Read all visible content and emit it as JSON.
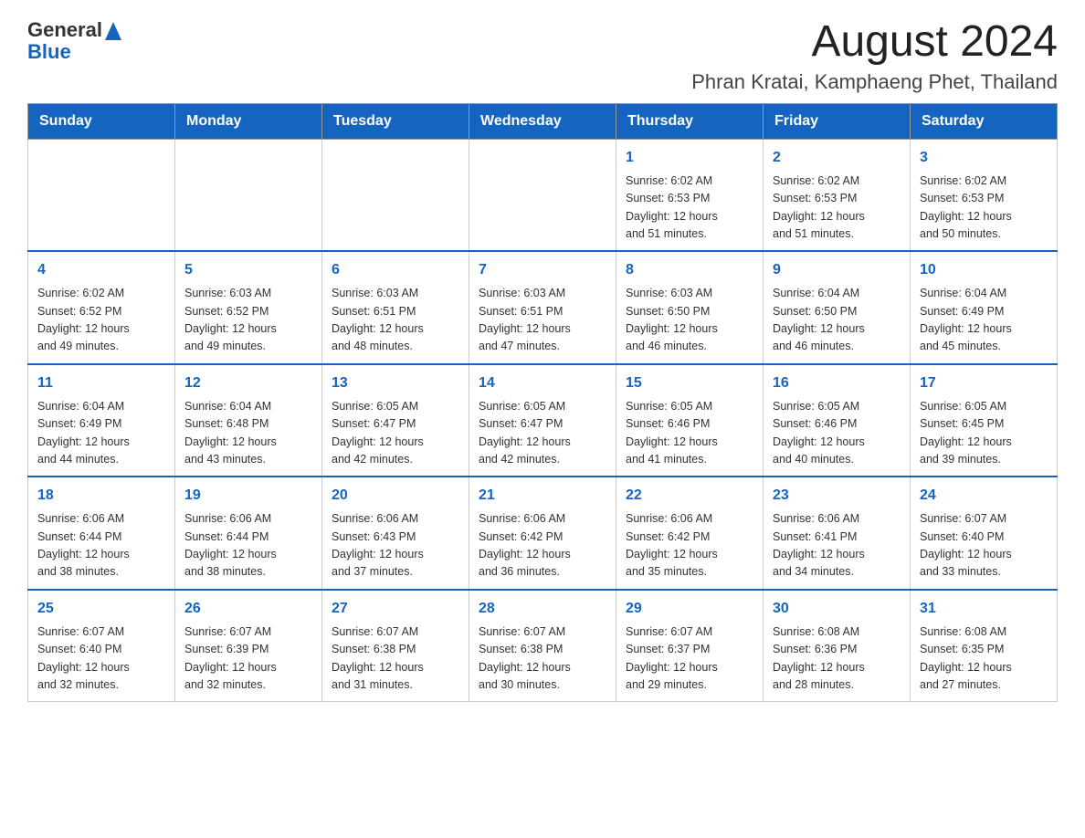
{
  "header": {
    "logo_general": "General",
    "logo_blue": "Blue",
    "month_title": "August 2024",
    "location": "Phran Kratai, Kamphaeng Phet, Thailand"
  },
  "calendar": {
    "days_of_week": [
      "Sunday",
      "Monday",
      "Tuesday",
      "Wednesday",
      "Thursday",
      "Friday",
      "Saturday"
    ],
    "weeks": [
      [
        {
          "day": "",
          "info": ""
        },
        {
          "day": "",
          "info": ""
        },
        {
          "day": "",
          "info": ""
        },
        {
          "day": "",
          "info": ""
        },
        {
          "day": "1",
          "info": "Sunrise: 6:02 AM\nSunset: 6:53 PM\nDaylight: 12 hours\nand 51 minutes."
        },
        {
          "day": "2",
          "info": "Sunrise: 6:02 AM\nSunset: 6:53 PM\nDaylight: 12 hours\nand 51 minutes."
        },
        {
          "day": "3",
          "info": "Sunrise: 6:02 AM\nSunset: 6:53 PM\nDaylight: 12 hours\nand 50 minutes."
        }
      ],
      [
        {
          "day": "4",
          "info": "Sunrise: 6:02 AM\nSunset: 6:52 PM\nDaylight: 12 hours\nand 49 minutes."
        },
        {
          "day": "5",
          "info": "Sunrise: 6:03 AM\nSunset: 6:52 PM\nDaylight: 12 hours\nand 49 minutes."
        },
        {
          "day": "6",
          "info": "Sunrise: 6:03 AM\nSunset: 6:51 PM\nDaylight: 12 hours\nand 48 minutes."
        },
        {
          "day": "7",
          "info": "Sunrise: 6:03 AM\nSunset: 6:51 PM\nDaylight: 12 hours\nand 47 minutes."
        },
        {
          "day": "8",
          "info": "Sunrise: 6:03 AM\nSunset: 6:50 PM\nDaylight: 12 hours\nand 46 minutes."
        },
        {
          "day": "9",
          "info": "Sunrise: 6:04 AM\nSunset: 6:50 PM\nDaylight: 12 hours\nand 46 minutes."
        },
        {
          "day": "10",
          "info": "Sunrise: 6:04 AM\nSunset: 6:49 PM\nDaylight: 12 hours\nand 45 minutes."
        }
      ],
      [
        {
          "day": "11",
          "info": "Sunrise: 6:04 AM\nSunset: 6:49 PM\nDaylight: 12 hours\nand 44 minutes."
        },
        {
          "day": "12",
          "info": "Sunrise: 6:04 AM\nSunset: 6:48 PM\nDaylight: 12 hours\nand 43 minutes."
        },
        {
          "day": "13",
          "info": "Sunrise: 6:05 AM\nSunset: 6:47 PM\nDaylight: 12 hours\nand 42 minutes."
        },
        {
          "day": "14",
          "info": "Sunrise: 6:05 AM\nSunset: 6:47 PM\nDaylight: 12 hours\nand 42 minutes."
        },
        {
          "day": "15",
          "info": "Sunrise: 6:05 AM\nSunset: 6:46 PM\nDaylight: 12 hours\nand 41 minutes."
        },
        {
          "day": "16",
          "info": "Sunrise: 6:05 AM\nSunset: 6:46 PM\nDaylight: 12 hours\nand 40 minutes."
        },
        {
          "day": "17",
          "info": "Sunrise: 6:05 AM\nSunset: 6:45 PM\nDaylight: 12 hours\nand 39 minutes."
        }
      ],
      [
        {
          "day": "18",
          "info": "Sunrise: 6:06 AM\nSunset: 6:44 PM\nDaylight: 12 hours\nand 38 minutes."
        },
        {
          "day": "19",
          "info": "Sunrise: 6:06 AM\nSunset: 6:44 PM\nDaylight: 12 hours\nand 38 minutes."
        },
        {
          "day": "20",
          "info": "Sunrise: 6:06 AM\nSunset: 6:43 PM\nDaylight: 12 hours\nand 37 minutes."
        },
        {
          "day": "21",
          "info": "Sunrise: 6:06 AM\nSunset: 6:42 PM\nDaylight: 12 hours\nand 36 minutes."
        },
        {
          "day": "22",
          "info": "Sunrise: 6:06 AM\nSunset: 6:42 PM\nDaylight: 12 hours\nand 35 minutes."
        },
        {
          "day": "23",
          "info": "Sunrise: 6:06 AM\nSunset: 6:41 PM\nDaylight: 12 hours\nand 34 minutes."
        },
        {
          "day": "24",
          "info": "Sunrise: 6:07 AM\nSunset: 6:40 PM\nDaylight: 12 hours\nand 33 minutes."
        }
      ],
      [
        {
          "day": "25",
          "info": "Sunrise: 6:07 AM\nSunset: 6:40 PM\nDaylight: 12 hours\nand 32 minutes."
        },
        {
          "day": "26",
          "info": "Sunrise: 6:07 AM\nSunset: 6:39 PM\nDaylight: 12 hours\nand 32 minutes."
        },
        {
          "day": "27",
          "info": "Sunrise: 6:07 AM\nSunset: 6:38 PM\nDaylight: 12 hours\nand 31 minutes."
        },
        {
          "day": "28",
          "info": "Sunrise: 6:07 AM\nSunset: 6:38 PM\nDaylight: 12 hours\nand 30 minutes."
        },
        {
          "day": "29",
          "info": "Sunrise: 6:07 AM\nSunset: 6:37 PM\nDaylight: 12 hours\nand 29 minutes."
        },
        {
          "day": "30",
          "info": "Sunrise: 6:08 AM\nSunset: 6:36 PM\nDaylight: 12 hours\nand 28 minutes."
        },
        {
          "day": "31",
          "info": "Sunrise: 6:08 AM\nSunset: 6:35 PM\nDaylight: 12 hours\nand 27 minutes."
        }
      ]
    ]
  }
}
